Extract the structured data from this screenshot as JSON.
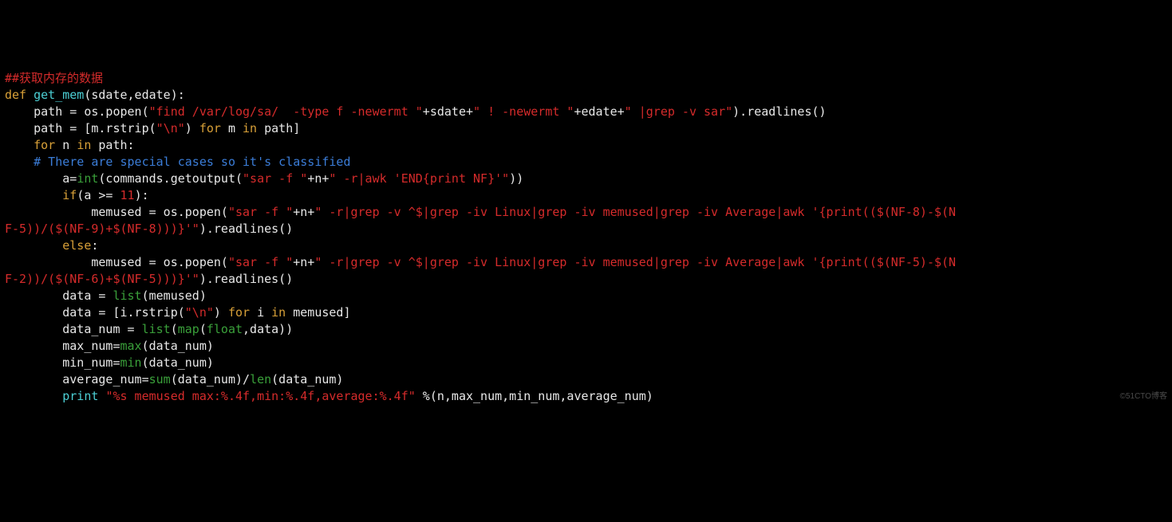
{
  "line1": {
    "a": "##获取内存的数据"
  },
  "line2": {
    "a": "def ",
    "b": "get_mem",
    "c": "(sdate,edate):"
  },
  "line3": {
    "a": "    path = os.popen(",
    "b": "\"find /var/log/sa/  -type f -newermt \"",
    "c": "+sdate+",
    "d": "\" ! -newermt \"",
    "e": "+edate+",
    "f": "\" |grep -v sar\"",
    "g": ").readlines()"
  },
  "line4": {
    "a": "    path = [m.rstrip(",
    "b": "\"\\n\"",
    "c": ") ",
    "d": "for ",
    "e": "m ",
    "f": "in ",
    "g": "path]"
  },
  "line5": {
    "a": "    ",
    "b": "for ",
    "c": "n ",
    "d": "in ",
    "e": "path:"
  },
  "line6": {
    "a": "    # There are special cases so it's classified"
  },
  "line7": {
    "a": "        a=",
    "b": "int",
    "c": "(commands.getoutput(",
    "d": "\"sar -f \"",
    "e": "+n+",
    "f": "\" -r|awk 'END{print NF}'\"",
    "g": "))"
  },
  "line8": {
    "a": "        ",
    "b": "if",
    "c": "(a >= ",
    "d": "11",
    "e": "):"
  },
  "line9": {
    "a": "            memused = os.popen(",
    "b": "\"sar -f \"",
    "c": "+n+",
    "d": "\" -r|grep -v ^$|grep -iv Linux|grep -iv memused|grep -iv Average|awk '{print(($(NF-8)-$(N"
  },
  "line10": {
    "a": "F-5))/($(NF-9)+$(NF-8)))}'\"",
    "b": ").readlines()"
  },
  "line11": {
    "a": "        ",
    "b": "else",
    "c": ":"
  },
  "line12": {
    "a": "            memused = os.popen(",
    "b": "\"sar -f \"",
    "c": "+n+",
    "d": "\" -r|grep -v ^$|grep -iv Linux|grep -iv memused|grep -iv Average|awk '{print(($(NF-5)-$(N"
  },
  "line13": {
    "a": "F-2))/($(NF-6)+$(NF-5)))}'\"",
    "b": ").readlines()"
  },
  "line14": {
    "a": "        data = ",
    "b": "list",
    "c": "(memused)"
  },
  "line15": {
    "a": "        data = [i.rstrip(",
    "b": "\"\\n\"",
    "c": ") ",
    "d": "for ",
    "e": "i ",
    "f": "in ",
    "g": "memused]"
  },
  "line16": {
    "a": "        data_num = ",
    "b": "list",
    "c": "(",
    "d": "map",
    "e": "(",
    "f": "float",
    "g": ",data))"
  },
  "line17": {
    "a": "        max_num=",
    "b": "max",
    "c": "(data_num)"
  },
  "line18": {
    "a": "        min_num=",
    "b": "min",
    "c": "(data_num)"
  },
  "line19": {
    "a": "        average_num=",
    "b": "sum",
    "c": "(data_num)/",
    "d": "len",
    "e": "(data_num)"
  },
  "line20": {
    "a": "        ",
    "b": "print ",
    "c": "\"%s memused max:%.4f,min:%.4f,average:%.4f\" ",
    "d": "%(n,max_num,min_num,average_num)"
  },
  "watermark": "©51CTO博客"
}
